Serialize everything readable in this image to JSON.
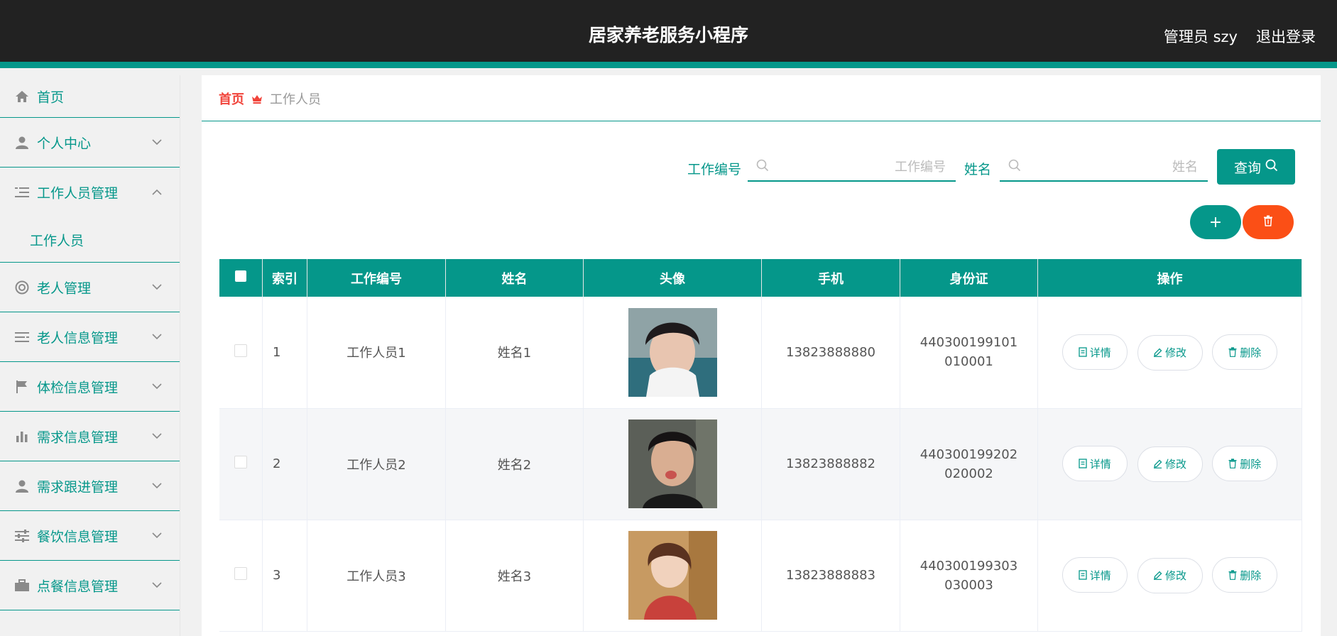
{
  "app": {
    "title": "居家养老服务小程序",
    "admin": "管理员 szy",
    "logout": "退出登录",
    "accent": "#05978a",
    "danger": "#fb4f16"
  },
  "sidebar": {
    "items": [
      {
        "label": "首页",
        "icon": "home-icon"
      },
      {
        "label": "个人中心",
        "icon": "user-icon"
      },
      {
        "label": "工作人员管理",
        "icon": "list-icon",
        "expanded": true
      },
      {
        "label": "工作人员",
        "submenu": true
      },
      {
        "label": "老人管理",
        "icon": "lifebuoy-icon"
      },
      {
        "label": "老人信息管理",
        "icon": "menu-icon"
      },
      {
        "label": "体检信息管理",
        "icon": "flag-icon"
      },
      {
        "label": "需求信息管理",
        "icon": "bar-chart-icon"
      },
      {
        "label": "需求跟进管理",
        "icon": "user-icon"
      },
      {
        "label": "餐饮信息管理",
        "icon": "sliders-icon"
      },
      {
        "label": "点餐信息管理",
        "icon": "briefcase-icon"
      }
    ]
  },
  "breadcrumb": {
    "home": "首页",
    "current": "工作人员"
  },
  "search": {
    "label1": "工作编号",
    "placeholder1": "工作编号",
    "value1": "",
    "label2": "姓名",
    "placeholder2": "姓名",
    "value2": "",
    "query_label": "查询"
  },
  "actions": {
    "add_symbol": "+"
  },
  "table": {
    "headers": [
      "索引",
      "工作编号",
      "姓名",
      "头像",
      "手机",
      "身份证",
      "操作"
    ],
    "rows": [
      {
        "index": "1",
        "code": "工作人员1",
        "name": "姓名1",
        "phone": "13823888880",
        "idcard": "440300199101010001"
      },
      {
        "index": "2",
        "code": "工作人员2",
        "name": "姓名2",
        "phone": "13823888882",
        "idcard": "440300199202020002"
      },
      {
        "index": "3",
        "code": "工作人员3",
        "name": "姓名3",
        "phone": "13823888883",
        "idcard": "440300199303030003"
      }
    ],
    "ops": {
      "detail": "详情",
      "edit": "修改",
      "delete": "删除"
    }
  }
}
